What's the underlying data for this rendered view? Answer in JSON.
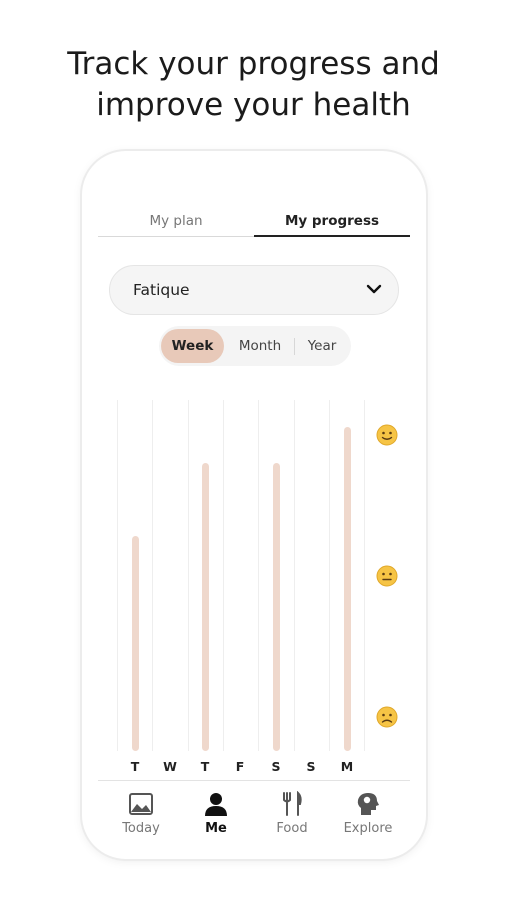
{
  "headline": {
    "line1": "Track your progress and",
    "line2": "improve your health"
  },
  "tabs": [
    {
      "label": "My plan",
      "active": false
    },
    {
      "label": "My progress",
      "active": true
    }
  ],
  "metric_select": {
    "value": "Fatique",
    "icon": "chevron-down-icon"
  },
  "period": {
    "options": [
      "Week",
      "Month",
      "Year"
    ],
    "selected": "Week"
  },
  "chart_data": {
    "type": "bar",
    "categories": [
      "T",
      "W",
      "T",
      "F",
      "S",
      "S",
      "M"
    ],
    "values": [
      1.25,
      null,
      1.75,
      null,
      1.75,
      null,
      2.0
    ],
    "ylim": [
      0,
      2
    ],
    "y_scale_icons": [
      "slightly-smiling-face-icon",
      "neutral-face-icon",
      "slightly-frowning-face-icon"
    ],
    "colors": {
      "bar": "#efd8cc",
      "grid": "#eeeeee"
    }
  },
  "bottom_nav": [
    {
      "label": "Today",
      "icon": "today-calendar-icon",
      "active": false
    },
    {
      "label": "Me",
      "icon": "person-icon",
      "active": true
    },
    {
      "label": "Food",
      "icon": "fork-knife-icon",
      "active": false
    },
    {
      "label": "Explore",
      "icon": "brain-head-icon",
      "active": false
    }
  ],
  "colors": {
    "accent": "#e8c9b9",
    "text": "#222222",
    "muted": "#777777"
  }
}
